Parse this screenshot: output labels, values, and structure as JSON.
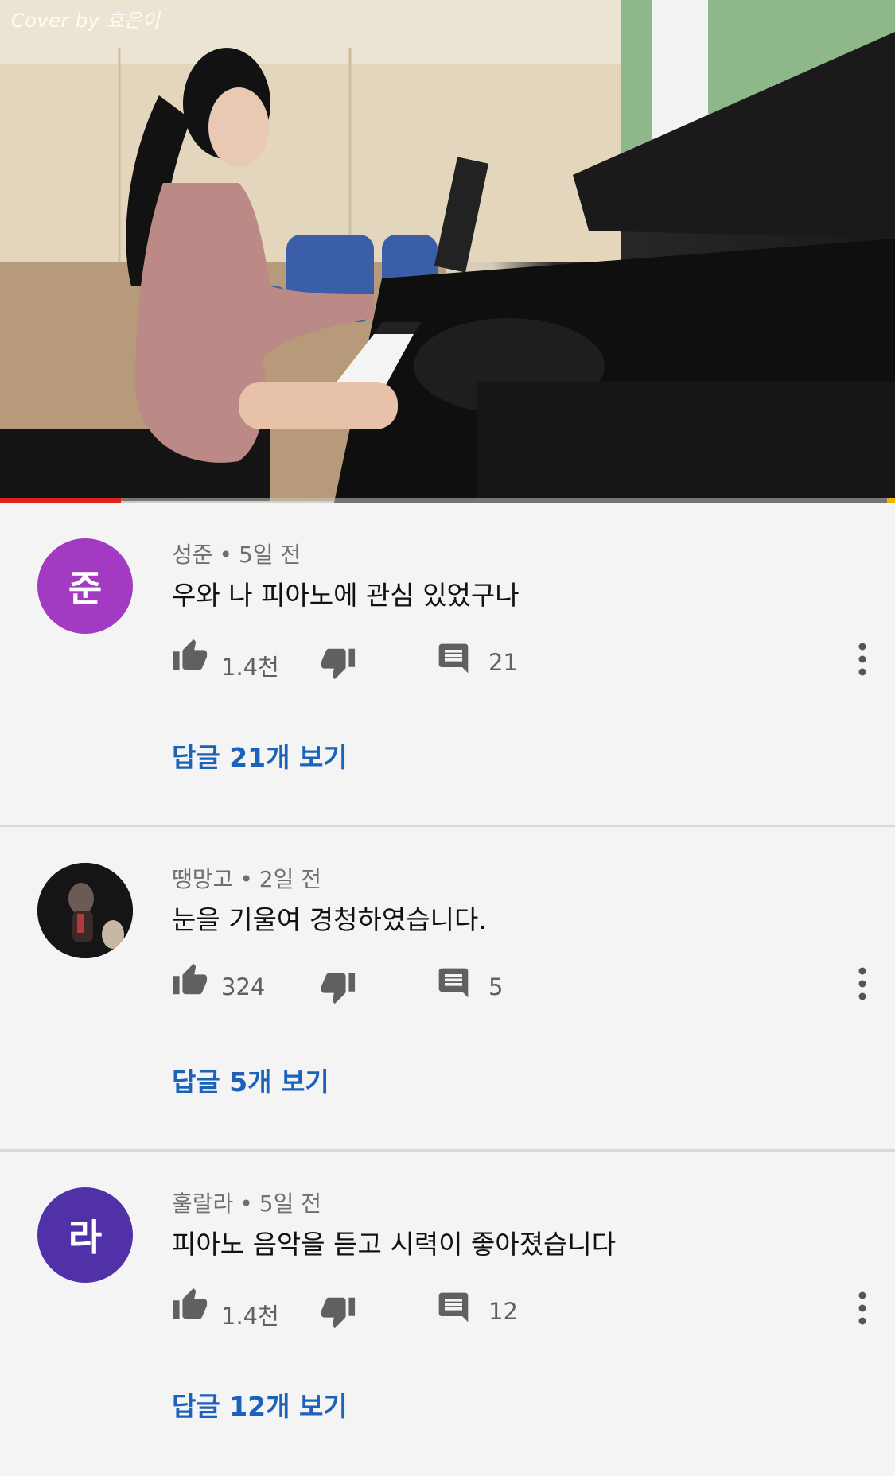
{
  "video": {
    "watermark": "Cover by 효은이",
    "progress_fraction": 0.135,
    "colors": {
      "progress": "#e1211c",
      "track": "#c8c8c8"
    }
  },
  "comments": [
    {
      "avatar_letter": "준",
      "avatar_color": "#a23bc2",
      "author": "성준",
      "time": "5일 전",
      "text": "우와 나 피아노에 관심 있었구나",
      "likes": "1.4천",
      "reply_count": "21",
      "replies_label": "답글 21개 보기"
    },
    {
      "avatar_letter": "",
      "avatar_color": "#1b1b1b",
      "author": "땡망고",
      "time": "2일 전",
      "text": "눈을 기울여 경청하였습니다.",
      "likes": "324",
      "reply_count": "5",
      "replies_label": "답글 5개 보기"
    },
    {
      "avatar_letter": "라",
      "avatar_color": "#5131a8",
      "author": "훌랄라",
      "time": "5일 전",
      "text": "피아노 음악을 듣고 시력이 좋아졌습니다",
      "likes": "1.4천",
      "reply_count": "12",
      "replies_label": "답글 12개 보기"
    }
  ],
  "icons": {
    "like": "thumb-up-icon",
    "dislike": "thumb-down-icon",
    "reply": "comment-icon",
    "more": "more-vertical-icon"
  }
}
